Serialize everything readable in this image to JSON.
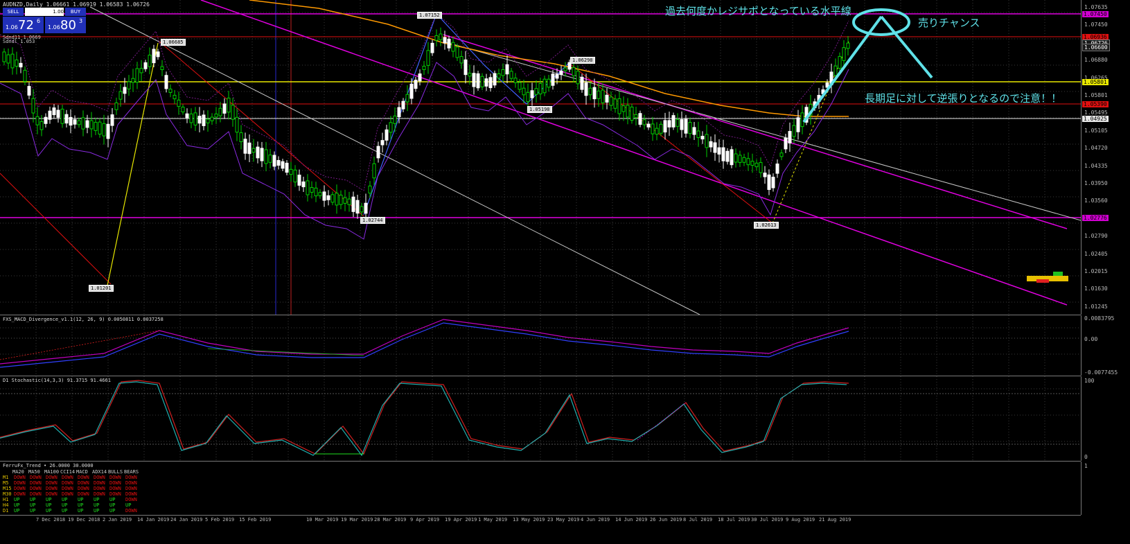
{
  "chart": {
    "title": "AUDNZD,Daily  1.06661 1.06919 1.06583 1.06726",
    "symbol": "AUDNZD",
    "timeframe": "Daily",
    "ohlc": [
      "1.06661",
      "1.06919",
      "1.06583",
      "1.06726"
    ]
  },
  "trade_panel": {
    "sell_label": "SELL",
    "buy_label": "BUY",
    "quantity": "1.00",
    "sell_prefix": "1.06",
    "sell_big": "72",
    "sell_sup": "6",
    "buy_prefix": "1.06",
    "buy_big": "80",
    "buy_sup": "3"
  },
  "legend_lines": [
    "Sdnd11 1.0669",
    "Sdndl 1.053"
  ],
  "price_axis": {
    "labels": [
      "1.07635",
      "1.07450",
      "1.07265",
      "1.06880",
      "1.06265",
      "1.05801",
      "1.05495",
      "1.05105",
      "1.04720",
      "1.04335",
      "1.03950",
      "1.03560",
      "1.03175",
      "1.02790",
      "1.02405",
      "1.02015",
      "1.01630",
      "1.01245"
    ],
    "tags": [
      {
        "text": "1.07450",
        "color": "#d000d0"
      },
      {
        "text": "1.06936",
        "color": "#e01010"
      },
      {
        "text": "1.06726",
        "color": "#1a1a1a"
      },
      {
        "text": "1.06600",
        "color": "#1a1a1a"
      },
      {
        "text": "1.05801",
        "color": "#e8e800"
      },
      {
        "text": "1.05390",
        "color": "#e01010"
      },
      {
        "text": "1.04925",
        "color": "#e8e8e8"
      },
      {
        "text": "1.02776",
        "color": "#d000d0"
      }
    ]
  },
  "zigzag_labels": [
    "1.07152",
    "1.06685",
    "1.06298",
    "1.05198",
    "1.02744",
    "1.02613",
    "1.01201"
  ],
  "annotations": {
    "resistance_text": "過去何度かレジサポとなっている水平線",
    "sell_chance": "売りチャンス",
    "warning": "長期足に対して逆張りとなるので注意！！"
  },
  "macd": {
    "title": "FXS_MACD_Divergence_v1.1(12, 26, 9) 0.0050811 0.0037258",
    "axis": [
      "0.0083795",
      "0.00",
      "-0.0077455"
    ]
  },
  "stochastic": {
    "title": "D1 Stochastic(14,3,3) 91.3715 91.4661",
    "axis": [
      "100",
      "0"
    ]
  },
  "trend": {
    "title": "FerruFx_Trend • 26.0000 30.0000",
    "headers": [
      "MA20",
      "MA50",
      "MA100",
      "CCI14",
      "MACD",
      "ADX14",
      "BULLS",
      "BEARS"
    ],
    "rows": [
      {
        "tf": "M1",
        "cells": [
          "DOWN",
          "DOWN",
          "DOWN",
          "DOWN",
          "DOWN",
          "DOWN",
          "DOWN",
          "DOWN"
        ]
      },
      {
        "tf": "M5",
        "cells": [
          "DOWN",
          "DOWN",
          "DOWN",
          "DOWN",
          "DOWN",
          "DOWN",
          "DOWN",
          "DOWN"
        ]
      },
      {
        "tf": "M15",
        "cells": [
          "DOWN",
          "DOWN",
          "DOWN",
          "DOWN",
          "DOWN",
          "DOWN",
          "DOWN",
          "DOWN"
        ]
      },
      {
        "tf": "M30",
        "cells": [
          "DOWN",
          "DOWN",
          "DOWN",
          "DOWN",
          "DOWN",
          "DOWN",
          "DOWN",
          "DOWN"
        ]
      },
      {
        "tf": "H1",
        "cells": [
          "UP",
          "UP",
          "UP",
          "UP",
          "UP",
          "UP",
          "UP",
          "DOWN"
        ]
      },
      {
        "tf": "H4",
        "cells": [
          "UP",
          "UP",
          "UP",
          "UP",
          "UP",
          "UP",
          "UP",
          "UP"
        ]
      },
      {
        "tf": "D1",
        "cells": [
          "UP",
          "UP",
          "UP",
          "UP",
          "UP",
          "UP",
          "UP",
          "DOWN"
        ]
      }
    ]
  },
  "time_axis": [
    "7 Dec 2018",
    "19 Dec 2018",
    "2 Jan 2019",
    "14 Jan 2019",
    "24 Jan 2019",
    "5 Feb 2019",
    "15 Feb 2019",
    "10 Mar 2019",
    "19 Mar 2019",
    "28 Mar 2019",
    "9 Apr 2019",
    "19 Apr 2019",
    "1 May 2019",
    "13 May 2019",
    "23 May 2019",
    "4 Jun 2019",
    "14 Jun 2019",
    "26 Jun 2019",
    "8 Jul 2019",
    "18 Jul 2019",
    "30 Jul 2019",
    "9 Aug 2019",
    "21 Aug 2019"
  ],
  "colors": {
    "background": "#000000",
    "bull_candle": "#ffffff",
    "bear_candle": "#00ff00",
    "resistance": "#e000e0",
    "support_yellow": "#e8e800",
    "annotation": "#5fe1e8",
    "ma_orange": "#ff9900"
  }
}
